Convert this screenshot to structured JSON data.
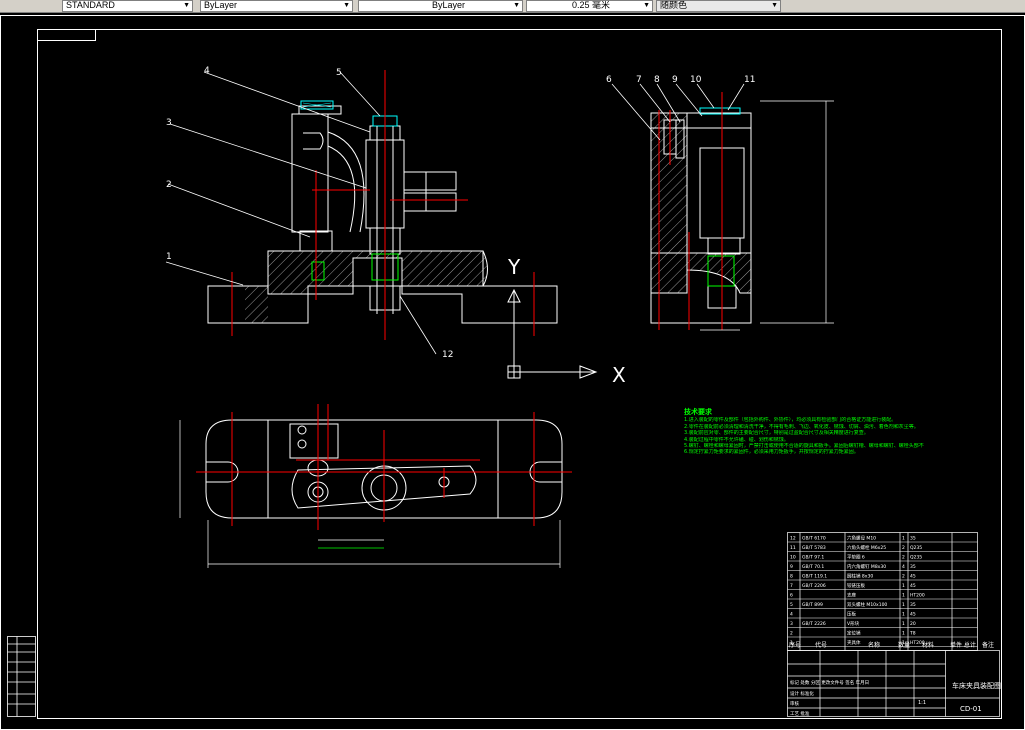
{
  "toolbar": {
    "fields": [
      {
        "value": "STANDARD"
      },
      {
        "value": "ByLayer"
      },
      {
        "value": "ByLayer"
      },
      {
        "value": "0.25 毫米"
      },
      {
        "value": "随颜色"
      }
    ]
  },
  "drawing": {
    "balloons": [
      "1",
      "2",
      "3",
      "4",
      "5",
      "6",
      "7",
      "8",
      "9",
      "10",
      "11",
      "12"
    ],
    "axis_y_label": "Y",
    "axis_x_label": "X",
    "tech_notes": {
      "title": "技术要求",
      "lines": [
        "1.进入装配的零件及部件（包括外购件、外协件），均必须具有检验部门的合格证方能进行装配。",
        "2.零件在装配前必须清理和清洗干净，不得有毛刺、飞边、氧化皮、锈蚀、切屑、油污、着色剂和灰尘等。",
        "3.装配前应对零、部件的主要配合尺寸，特别是过盈配合尺寸及相关精度进行复查。",
        "4.装配过程中零件不允许磕、碰、划伤和锈蚀。",
        "5.螺钉、螺栓和螺母紧固时，严禁打击或使用不合适的旋具和扳手。紧固后螺钉槽、螺母和螺钉、螺栓头部不得损坏。",
        "6.规定拧紧力矩要求的紧固件，必须采用力矩扳手，并按规定的拧紧力矩紧固。"
      ]
    },
    "title_block": {
      "drawing_title": "车床夹具装配图",
      "drawing_no": "CD-01",
      "scale": "1:1",
      "header_cols": [
        "序号",
        "代号",
        "名称",
        "数量",
        "材料",
        "单件 总计",
        "备注"
      ],
      "parts": [
        {
          "no": "12",
          "code": "GB/T 6170",
          "name": "六角螺母 M10",
          "qty": "1",
          "mat": "35"
        },
        {
          "no": "11",
          "code": "GB/T 5783",
          "name": "六角头螺栓 M6x25",
          "qty": "2",
          "mat": "Q235"
        },
        {
          "no": "10",
          "code": "GB/T 97.1",
          "name": "平垫圈 6",
          "qty": "2",
          "mat": "Q235"
        },
        {
          "no": "9",
          "code": "GB/T 70.1",
          "name": "内六角螺钉 M8x30",
          "qty": "4",
          "mat": "35"
        },
        {
          "no": "8",
          "code": "GB/T 119.1",
          "name": "圆柱销 8x30",
          "qty": "2",
          "mat": "45"
        },
        {
          "no": "7",
          "code": "GB/T 2206",
          "name": "铰链压板",
          "qty": "1",
          "mat": "45"
        },
        {
          "no": "6",
          "code": "",
          "name": "支座",
          "qty": "1",
          "mat": "HT200"
        },
        {
          "no": "5",
          "code": "GB/T 899",
          "name": "双头螺柱 M10x100",
          "qty": "1",
          "mat": "35"
        },
        {
          "no": "4",
          "code": "",
          "name": "压板",
          "qty": "1",
          "mat": "45"
        },
        {
          "no": "3",
          "code": "GB/T 2226",
          "name": "V形块",
          "qty": "1",
          "mat": "20"
        },
        {
          "no": "2",
          "code": "",
          "name": "定位销",
          "qty": "1",
          "mat": "T8"
        },
        {
          "no": "1",
          "code": "",
          "name": "夹具体",
          "qty": "1",
          "mat": "HT200"
        }
      ],
      "sign_rows": [
        "标记 处数 分区 更改文件号 签名 年月日",
        "设计 标准化",
        "审核",
        "工艺 批准"
      ]
    }
  }
}
